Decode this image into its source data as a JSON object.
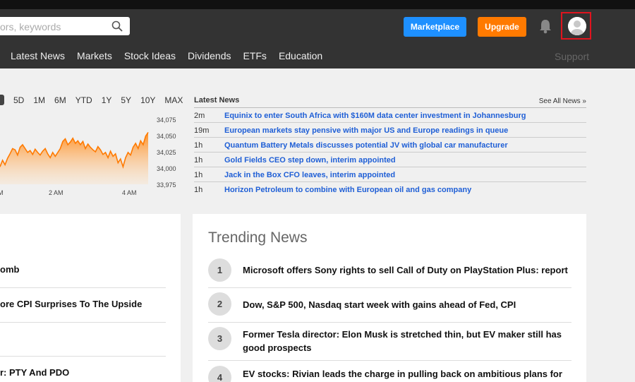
{
  "search": {
    "placeholder": "ors, keywords"
  },
  "header": {
    "marketplace_label": "Marketplace",
    "upgrade_label": "Upgrade",
    "support_label": "Support",
    "colors": {
      "bar": "#333333",
      "marketplace": "#1e90ff",
      "upgrade": "#ff7a00",
      "highlight": "#e0141e"
    },
    "icons": [
      "search-icon",
      "bell-icon",
      "user-avatar-icon"
    ]
  },
  "nav": {
    "items": [
      "Latest News",
      "Markets",
      "Stock Ideas",
      "Dividends",
      "ETFs",
      "Education"
    ]
  },
  "chart_data": {
    "type": "area",
    "periods": [
      "5D",
      "1M",
      "6M",
      "YTD",
      "1Y",
      "5Y",
      "10Y",
      "MAX"
    ],
    "yticks": [
      "34,075",
      "34,050",
      "34,025",
      "34,000",
      "33,975"
    ],
    "xticks": [
      "2 AM",
      "4 AM"
    ],
    "ylim": [
      33975,
      34075
    ],
    "series_color": "#ff7a00",
    "values": [
      34002,
      34012,
      34005,
      34015,
      34022,
      34030,
      34028,
      34020,
      34032,
      34036,
      34030,
      34024,
      34027,
      34021,
      34029,
      34024,
      34020,
      34026,
      34030,
      34022,
      34016,
      34024,
      34018,
      34024,
      34030,
      34041,
      34045,
      34036,
      34040,
      34046,
      34038,
      34042,
      34036,
      34041,
      34030,
      34037,
      34032,
      34028,
      34025,
      34033,
      34028,
      34021,
      34024,
      34016,
      34026,
      34018,
      34022,
      34008,
      34014,
      34002,
      34016,
      34024,
      34020,
      34032,
      34038,
      34030,
      34042,
      34036,
      34049,
      34055
    ]
  },
  "latest_news": {
    "title": "Latest News",
    "see_all": "See All News »",
    "items": [
      {
        "time": "2m",
        "headline": "Equinix to enter South Africa with $160M data center investment in Johannesburg"
      },
      {
        "time": "19m",
        "headline": "European markets stay pensive with major US and Europe readings in queue"
      },
      {
        "time": "1h",
        "headline": "Quantum Battery Metals discusses potential JV with global car manufacturer"
      },
      {
        "time": "1h",
        "headline": "Gold Fields CEO step down, interim appointed"
      },
      {
        "time": "1h",
        "headline": "Jack in the Box CFO leaves, interim appointed"
      },
      {
        "time": "1h",
        "headline": "Horizon Petroleum to combine with European oil and gas company"
      }
    ]
  },
  "left_panel": {
    "items": [
      "omb",
      "ore CPI Surprises To The Upside",
      "r: PTY And PDO"
    ]
  },
  "trending": {
    "title": "Trending News",
    "items": [
      {
        "rank": "1",
        "headline": "Microsoft offers Sony rights to sell Call of Duty on PlayStation Plus: report"
      },
      {
        "rank": "2",
        "headline": "Dow, S&P 500, Nasdaq start week with gains ahead of Fed, CPI"
      },
      {
        "rank": "3",
        "headline": "Former Tesla director: Elon Musk is stretched thin, but EV maker still has good prospects"
      },
      {
        "rank": "4",
        "headline": "EV stocks: Rivian leads the charge in pulling back on ambitious plans for"
      }
    ]
  }
}
